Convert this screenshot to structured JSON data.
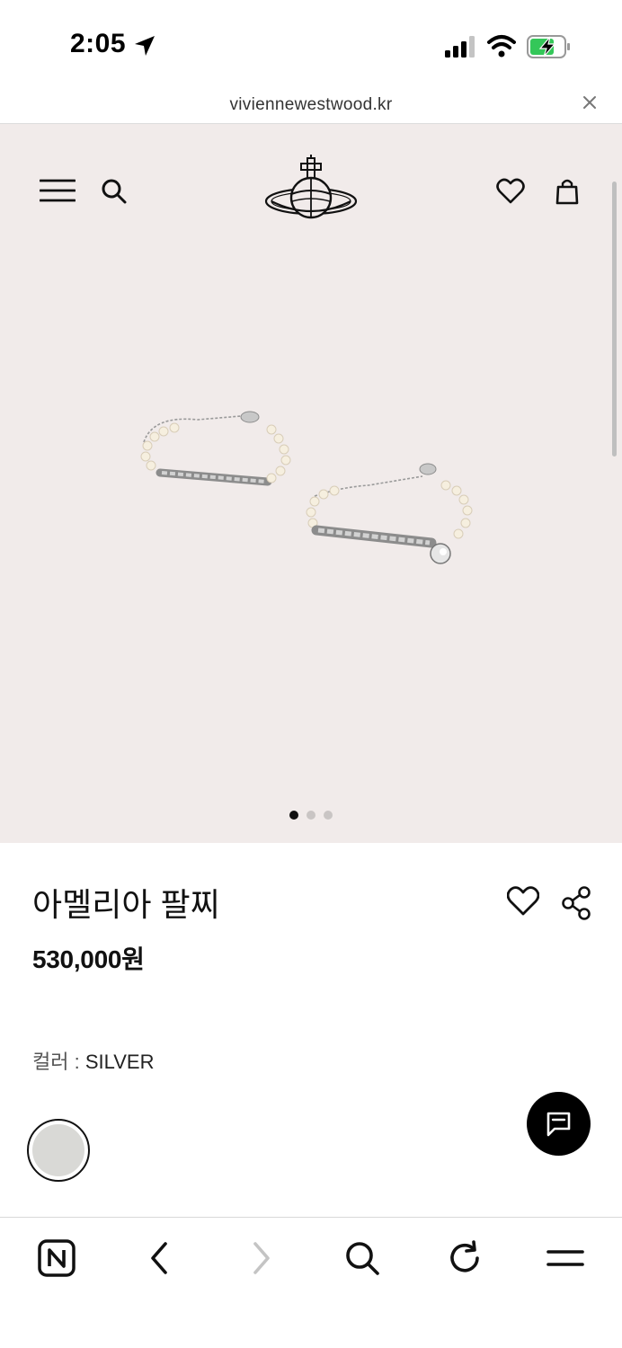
{
  "status_bar": {
    "time": "2:05",
    "icons": [
      "location-arrow-icon",
      "cellular-signal-icon",
      "wifi-icon",
      "battery-charging-icon"
    ],
    "battery_color": "#34c759"
  },
  "browser": {
    "url": "viviennewestwood.kr",
    "close_icon": "close-icon"
  },
  "site_header": {
    "icons": [
      "hamburger-menu-icon",
      "search-icon",
      "orb-logo",
      "heart-icon",
      "shopping-bag-icon"
    ]
  },
  "hero": {
    "background": "#f1ebea",
    "image_description_icon": "pearl-bracelets-image",
    "carousel": {
      "count": 3,
      "active_index": 0
    }
  },
  "product": {
    "title": "아멜리아 팔찌",
    "price": "530,000원",
    "color_label": "컬러 : ",
    "color_value": "SILVER",
    "swatch_color": "#d9d9d6"
  },
  "floating": {
    "chat_icon": "chat-bubble-icon"
  },
  "toolbar": {
    "items": [
      "naver-home-icon",
      "back-arrow-icon",
      "forward-arrow-icon",
      "search-icon",
      "refresh-icon",
      "menu-icon"
    ]
  }
}
